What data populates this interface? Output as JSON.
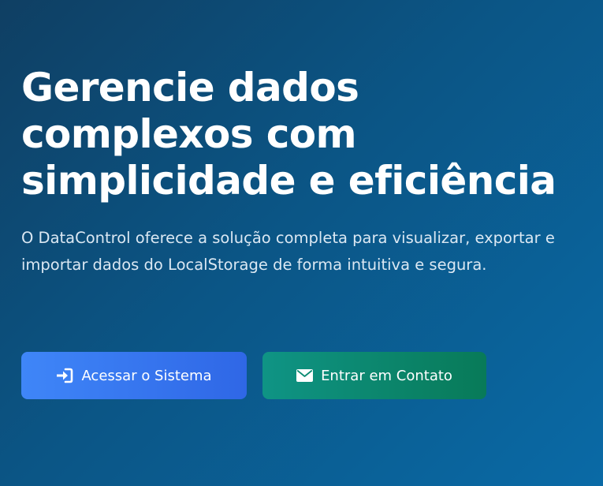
{
  "hero": {
    "title_lines": [
      "Gerencie dados",
      "complexos com",
      "simplicidade e eficiência"
    ],
    "description": "O DataControl oferece a solução completa para visualizar, exportar e importar dados do LocalStorage de forma intuitiva e segura."
  },
  "actions": {
    "access_label": "Acessar o Sistema",
    "access_icon": "sign-in-icon",
    "contact_label": "Entrar em Contato",
    "contact_icon": "envelope-icon"
  },
  "colors": {
    "background_start": "#0f3f63",
    "background_end": "#0a6aa6",
    "primary_button": "#3f86f8",
    "secondary_button": "#0f9485"
  }
}
